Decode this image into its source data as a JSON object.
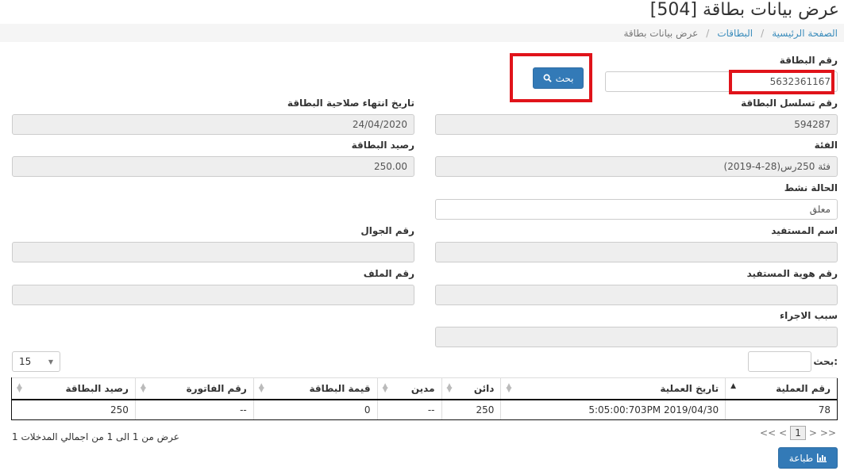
{
  "page": {
    "title": "عرض بيانات بطاقة [504]"
  },
  "breadcrumb": {
    "home": "الصفحة الرئيسية",
    "cards": "البطاقات",
    "current": "عرض بيانات بطاقة",
    "sep": "/"
  },
  "form": {
    "card_number_label": "رقم البطاقة",
    "card_number_value": "5632361167",
    "search_button": "بحث",
    "serial_label": "رقم تسلسل البطاقة",
    "serial_value": "594287",
    "expiry_label": "تاريخ انتهاء صلاحية البطاقة",
    "expiry_value": "24/04/2020",
    "category_label": "الفئة",
    "category_value": "فئة 250رس(28-4-2019)",
    "balance_label": "رصيد البطاقة",
    "balance_value": "250.00",
    "status_label": "الحالة نشط",
    "status_value": "معلق",
    "beneficiary_name_label": "اسم المستفيد",
    "beneficiary_name_value": "",
    "mobile_label": "رقم الجوال",
    "mobile_value": "",
    "beneficiary_id_label": "رقم هوية المستفيد",
    "beneficiary_id_value": "",
    "file_label": "رقم الملف",
    "file_value": "",
    "reason_label": "سبب الاجراء",
    "reason_value": ""
  },
  "table_controls": {
    "search_label": ":بحث",
    "search_value": "",
    "page_size": "15"
  },
  "table": {
    "headers": [
      "رقم العملية",
      "تاريخ العملية",
      "دائن",
      "مدين",
      "قيمة البطاقة",
      "رقم الفاتورة",
      "رصيد البطاقة"
    ],
    "rows": [
      [
        "78",
        "5:05:00:703PM 2019/04/30",
        "250",
        "--",
        "0",
        "--",
        "250"
      ]
    ]
  },
  "footer": {
    "info": "عرض من 1 الى 1 من اجمالي المدخلات 1",
    "pager_first": "<<",
    "pager_prev": "<",
    "pager_page": "1",
    "pager_next": ">",
    "pager_last": ">>",
    "print_button": "طباعة"
  },
  "colors": {
    "primary": "#337ab7",
    "highlight": "#e0131a",
    "link": "#3c8dbc"
  }
}
